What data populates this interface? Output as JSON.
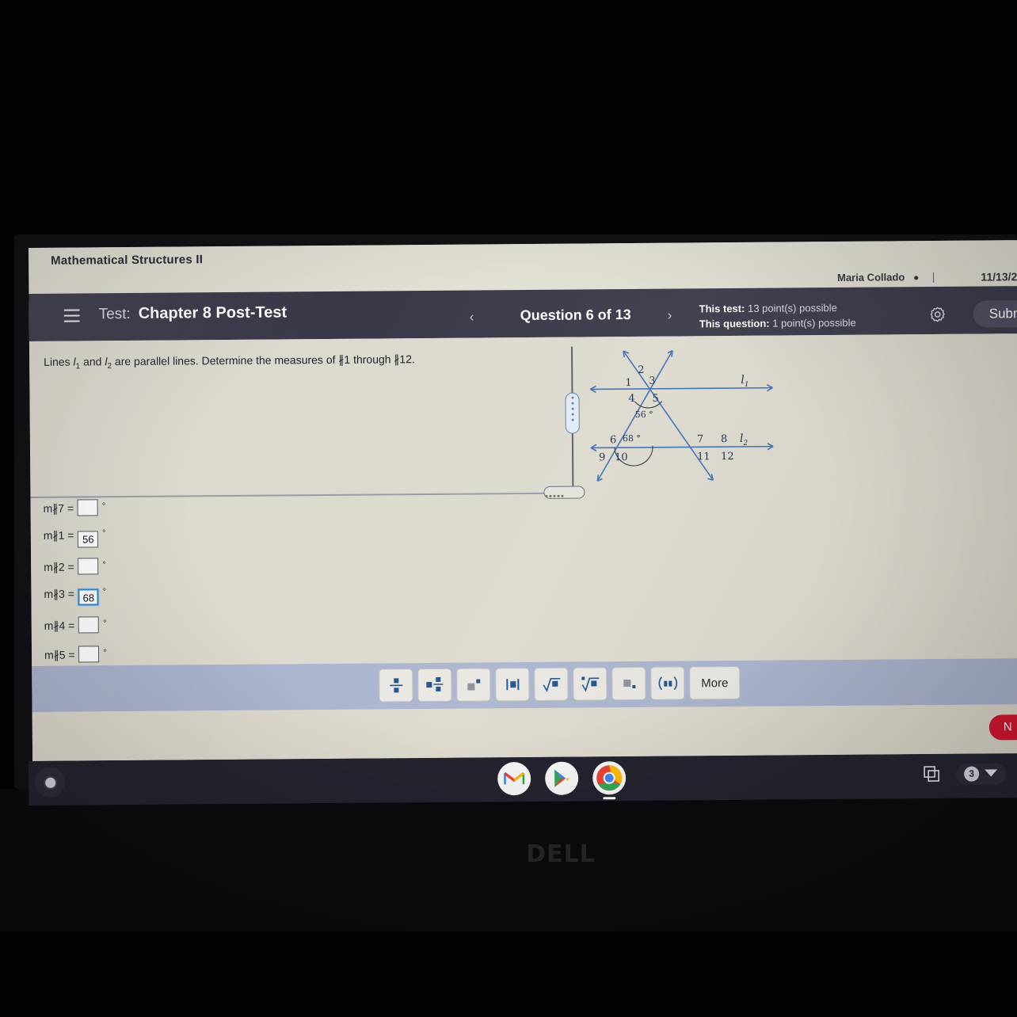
{
  "photo": {
    "device_brand": "DELL"
  },
  "browser": {
    "course_name": "Mathematical Structures II"
  },
  "user_strip": {
    "user_name": "Maria Collado",
    "user_icon": "person-icon",
    "divider": "|",
    "date": "11/13/2"
  },
  "test_toolbar": {
    "menu_icon": "hamburger-icon",
    "test_label": "Test:",
    "test_title": "Chapter 8 Post-Test",
    "prev_icon": "‹",
    "next_icon": "›",
    "question_counter": "Question 6 of 13",
    "points_test_label": "This test:",
    "points_test_value": "13 point(s) possible",
    "points_question_label": "This question:",
    "points_question_value": "1 point(s) possible",
    "settings_icon": "gear-icon",
    "submit_label": "Submit"
  },
  "question": {
    "prompt_part1": "Lines ",
    "prompt_l1": "l",
    "prompt_l1_sub": "1",
    "prompt_part2": " and ",
    "prompt_l2": "l",
    "prompt_l2_sub": "2",
    "prompt_part3": " are parallel lines. Determine the measures of ∦1 through ∦12."
  },
  "figure": {
    "type": "two-parallel-lines-two-transversals",
    "line_labels": [
      "l₁",
      "l₂"
    ],
    "given_angles": [
      {
        "value": "56°",
        "location": "below-upper-intersection"
      },
      {
        "value": "68°",
        "location": "above-left-lower-intersection"
      }
    ],
    "angle_numbers_upper": [
      "1",
      "2",
      "3",
      "4",
      "5"
    ],
    "angle_numbers_lower": [
      "6",
      "7",
      "8",
      "9",
      "10",
      "11",
      "12"
    ],
    "line_color": "#3d6fb5",
    "label_color": "#1b2a4a"
  },
  "answers": {
    "degree_symbol": "°",
    "rows": [
      {
        "label": "m∦7 =",
        "value": "",
        "focused": false
      },
      {
        "label": "m∦1 =",
        "value": "56",
        "focused": false
      },
      {
        "label": "m∦2 =",
        "value": "",
        "focused": false
      },
      {
        "label": "m∦3 =",
        "value": "68",
        "focused": true
      },
      {
        "label": "m∦4 =",
        "value": "",
        "focused": false
      },
      {
        "label": "m∦5 =",
        "value": "",
        "focused": false
      }
    ]
  },
  "math_palette": {
    "buttons": [
      {
        "name": "fraction-button",
        "glyph": "▪̸▪"
      },
      {
        "name": "mixed-number-button",
        "glyph": "▪"
      },
      {
        "name": "exponent-button",
        "glyph": "▪˙"
      },
      {
        "name": "absolute-value-button",
        "glyph": "|▪|"
      },
      {
        "name": "square-root-button",
        "glyph": "√▪"
      },
      {
        "name": "nth-root-button",
        "glyph": "∛▪"
      },
      {
        "name": "subscript-button",
        "glyph": "▪."
      },
      {
        "name": "parentheses-button",
        "glyph": "(▪▪)"
      },
      {
        "name": "more-button",
        "glyph": "More"
      }
    ],
    "more_label": "More"
  },
  "footer": {
    "next_label": "N"
  },
  "shelf": {
    "launcher_icon": "launcher-icon",
    "apps": [
      {
        "name": "gmail-icon",
        "label": "Gmail",
        "active": false
      },
      {
        "name": "play-store-icon",
        "label": "Play Store",
        "active": false
      },
      {
        "name": "chrome-icon",
        "label": "Chrome",
        "active": true
      }
    ],
    "tray": {
      "overview_icon": "window-overview-icon",
      "notification_count": "3",
      "wifi_icon": "wifi-icon"
    }
  },
  "colors": {
    "toolbar_bg": "#383848",
    "page_bg": "#dcd9ce",
    "palette_bg": "#aab4ce",
    "accent_blue": "#2e86c8",
    "figure_blue": "#3d6fb5",
    "next_red": "#d8152f"
  }
}
